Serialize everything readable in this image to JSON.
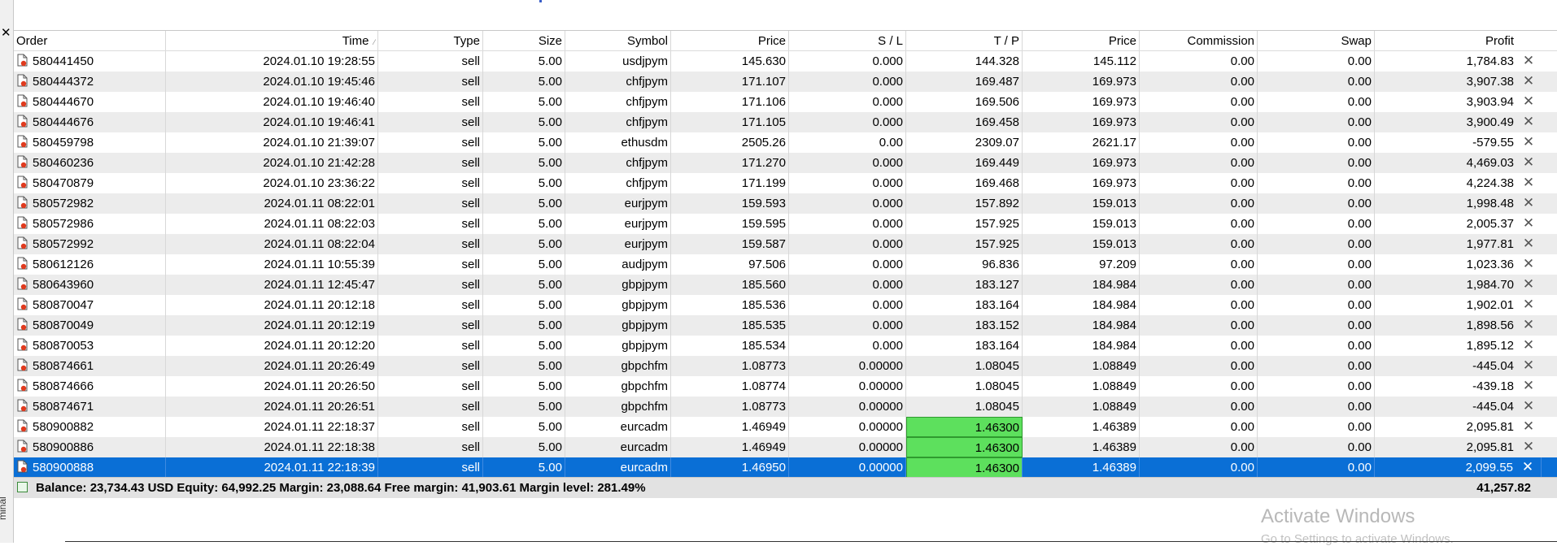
{
  "window": {
    "close_glyph": "✕",
    "side_label": "minal"
  },
  "table": {
    "columns": [
      "Order",
      "Time",
      "Type",
      "Size",
      "Symbol",
      "Price",
      "S / L",
      "T / P",
      "Price",
      "Commission",
      "Swap",
      "Profit"
    ],
    "sort_indicator": "⁄",
    "rows": [
      [
        "580441450",
        "2024.01.10 19:28:55",
        "sell",
        "5.00",
        "usdjpym",
        "145.630",
        "0.000",
        "144.328",
        "145.112",
        "0.00",
        "0.00",
        "1,784.83"
      ],
      [
        "580444372",
        "2024.01.10 19:45:46",
        "sell",
        "5.00",
        "chfjpym",
        "171.107",
        "0.000",
        "169.487",
        "169.973",
        "0.00",
        "0.00",
        "3,907.38"
      ],
      [
        "580444670",
        "2024.01.10 19:46:40",
        "sell",
        "5.00",
        "chfjpym",
        "171.106",
        "0.000",
        "169.506",
        "169.973",
        "0.00",
        "0.00",
        "3,903.94"
      ],
      [
        "580444676",
        "2024.01.10 19:46:41",
        "sell",
        "5.00",
        "chfjpym",
        "171.105",
        "0.000",
        "169.458",
        "169.973",
        "0.00",
        "0.00",
        "3,900.49"
      ],
      [
        "580459798",
        "2024.01.10 21:39:07",
        "sell",
        "5.00",
        "ethusdm",
        "2505.26",
        "0.00",
        "2309.07",
        "2621.17",
        "0.00",
        "0.00",
        "-579.55"
      ],
      [
        "580460236",
        "2024.01.10 21:42:28",
        "sell",
        "5.00",
        "chfjpym",
        "171.270",
        "0.000",
        "169.449",
        "169.973",
        "0.00",
        "0.00",
        "4,469.03"
      ],
      [
        "580470879",
        "2024.01.10 23:36:22",
        "sell",
        "5.00",
        "chfjpym",
        "171.199",
        "0.000",
        "169.468",
        "169.973",
        "0.00",
        "0.00",
        "4,224.38"
      ],
      [
        "580572982",
        "2024.01.11 08:22:01",
        "sell",
        "5.00",
        "eurjpym",
        "159.593",
        "0.000",
        "157.892",
        "159.013",
        "0.00",
        "0.00",
        "1,998.48"
      ],
      [
        "580572986",
        "2024.01.11 08:22:03",
        "sell",
        "5.00",
        "eurjpym",
        "159.595",
        "0.000",
        "157.925",
        "159.013",
        "0.00",
        "0.00",
        "2,005.37"
      ],
      [
        "580572992",
        "2024.01.11 08:22:04",
        "sell",
        "5.00",
        "eurjpym",
        "159.587",
        "0.000",
        "157.925",
        "159.013",
        "0.00",
        "0.00",
        "1,977.81"
      ],
      [
        "580612126",
        "2024.01.11 10:55:39",
        "sell",
        "5.00",
        "audjpym",
        "97.506",
        "0.000",
        "96.836",
        "97.209",
        "0.00",
        "0.00",
        "1,023.36"
      ],
      [
        "580643960",
        "2024.01.11 12:45:47",
        "sell",
        "5.00",
        "gbpjpym",
        "185.560",
        "0.000",
        "183.127",
        "184.984",
        "0.00",
        "0.00",
        "1,984.70"
      ],
      [
        "580870047",
        "2024.01.11 20:12:18",
        "sell",
        "5.00",
        "gbpjpym",
        "185.536",
        "0.000",
        "183.164",
        "184.984",
        "0.00",
        "0.00",
        "1,902.01"
      ],
      [
        "580870049",
        "2024.01.11 20:12:19",
        "sell",
        "5.00",
        "gbpjpym",
        "185.535",
        "0.000",
        "183.152",
        "184.984",
        "0.00",
        "0.00",
        "1,898.56"
      ],
      [
        "580870053",
        "2024.01.11 20:12:20",
        "sell",
        "5.00",
        "gbpjpym",
        "185.534",
        "0.000",
        "183.164",
        "184.984",
        "0.00",
        "0.00",
        "1,895.12"
      ],
      [
        "580874661",
        "2024.01.11 20:26:49",
        "sell",
        "5.00",
        "gbpchfm",
        "1.08773",
        "0.00000",
        "1.08045",
        "1.08849",
        "0.00",
        "0.00",
        "-445.04"
      ],
      [
        "580874666",
        "2024.01.11 20:26:50",
        "sell",
        "5.00",
        "gbpchfm",
        "1.08774",
        "0.00000",
        "1.08045",
        "1.08849",
        "0.00",
        "0.00",
        "-439.18"
      ],
      [
        "580874671",
        "2024.01.11 20:26:51",
        "sell",
        "5.00",
        "gbpchfm",
        "1.08773",
        "0.00000",
        "1.08045",
        "1.08849",
        "0.00",
        "0.00",
        "-445.04"
      ],
      [
        "580900882",
        "2024.01.11 22:18:37",
        "sell",
        "5.00",
        "eurcadm",
        "1.46949",
        "0.00000",
        "1.46300",
        "1.46389",
        "0.00",
        "0.00",
        "2,095.81"
      ],
      [
        "580900886",
        "2024.01.11 22:18:38",
        "sell",
        "5.00",
        "eurcadm",
        "1.46949",
        "0.00000",
        "1.46300",
        "1.46389",
        "0.00",
        "0.00",
        "2,095.81"
      ],
      [
        "580900888",
        "2024.01.11 22:18:39",
        "sell",
        "5.00",
        "eurcadm",
        "1.46950",
        "0.00000",
        "1.46300",
        "1.46389",
        "0.00",
        "0.00",
        "2,099.55"
      ]
    ],
    "selected_row": 20,
    "tp_highlight_rows": [
      18,
      19,
      20
    ],
    "tp_highlight_color": "#5de05d",
    "selection_color": "#0a6fd6",
    "row_close_glyph": "✕"
  },
  "summary": {
    "text": "Balance: 23,734.43 USD  Equity: 64,992.25  Margin: 23,088.64  Free margin: 41,903.61  Margin level: 281.49%",
    "total": "41,257.82"
  },
  "watermark": {
    "title": "Activate Windows",
    "subtitle": "Go to Settings to activate Windows."
  }
}
